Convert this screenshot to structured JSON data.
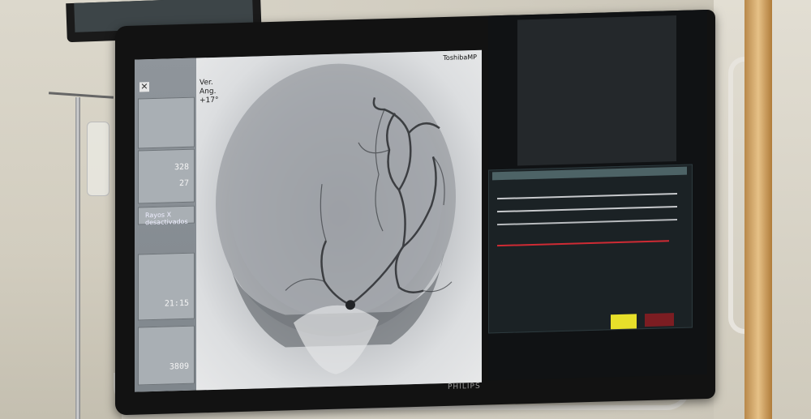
{
  "monitor": {
    "brand": "PHILIPS"
  },
  "angio": {
    "device_label": "ToshibaMP",
    "view_angle_lines": [
      "Ver.",
      "Ang.",
      "+17°"
    ],
    "info_values": [
      "328",
      "27",
      "21:15",
      "3809"
    ],
    "info_caption": "Rayos X desactivados",
    "close_icon": "close-icon"
  },
  "vitals": {
    "alarm_colors": {
      "yellow": "#e7e02a",
      "red": "#7c1d22"
    },
    "trace_colors": [
      "#c7c9cc",
      "#c7c9cc",
      "#b8bbbe",
      "#cf2b34"
    ]
  }
}
